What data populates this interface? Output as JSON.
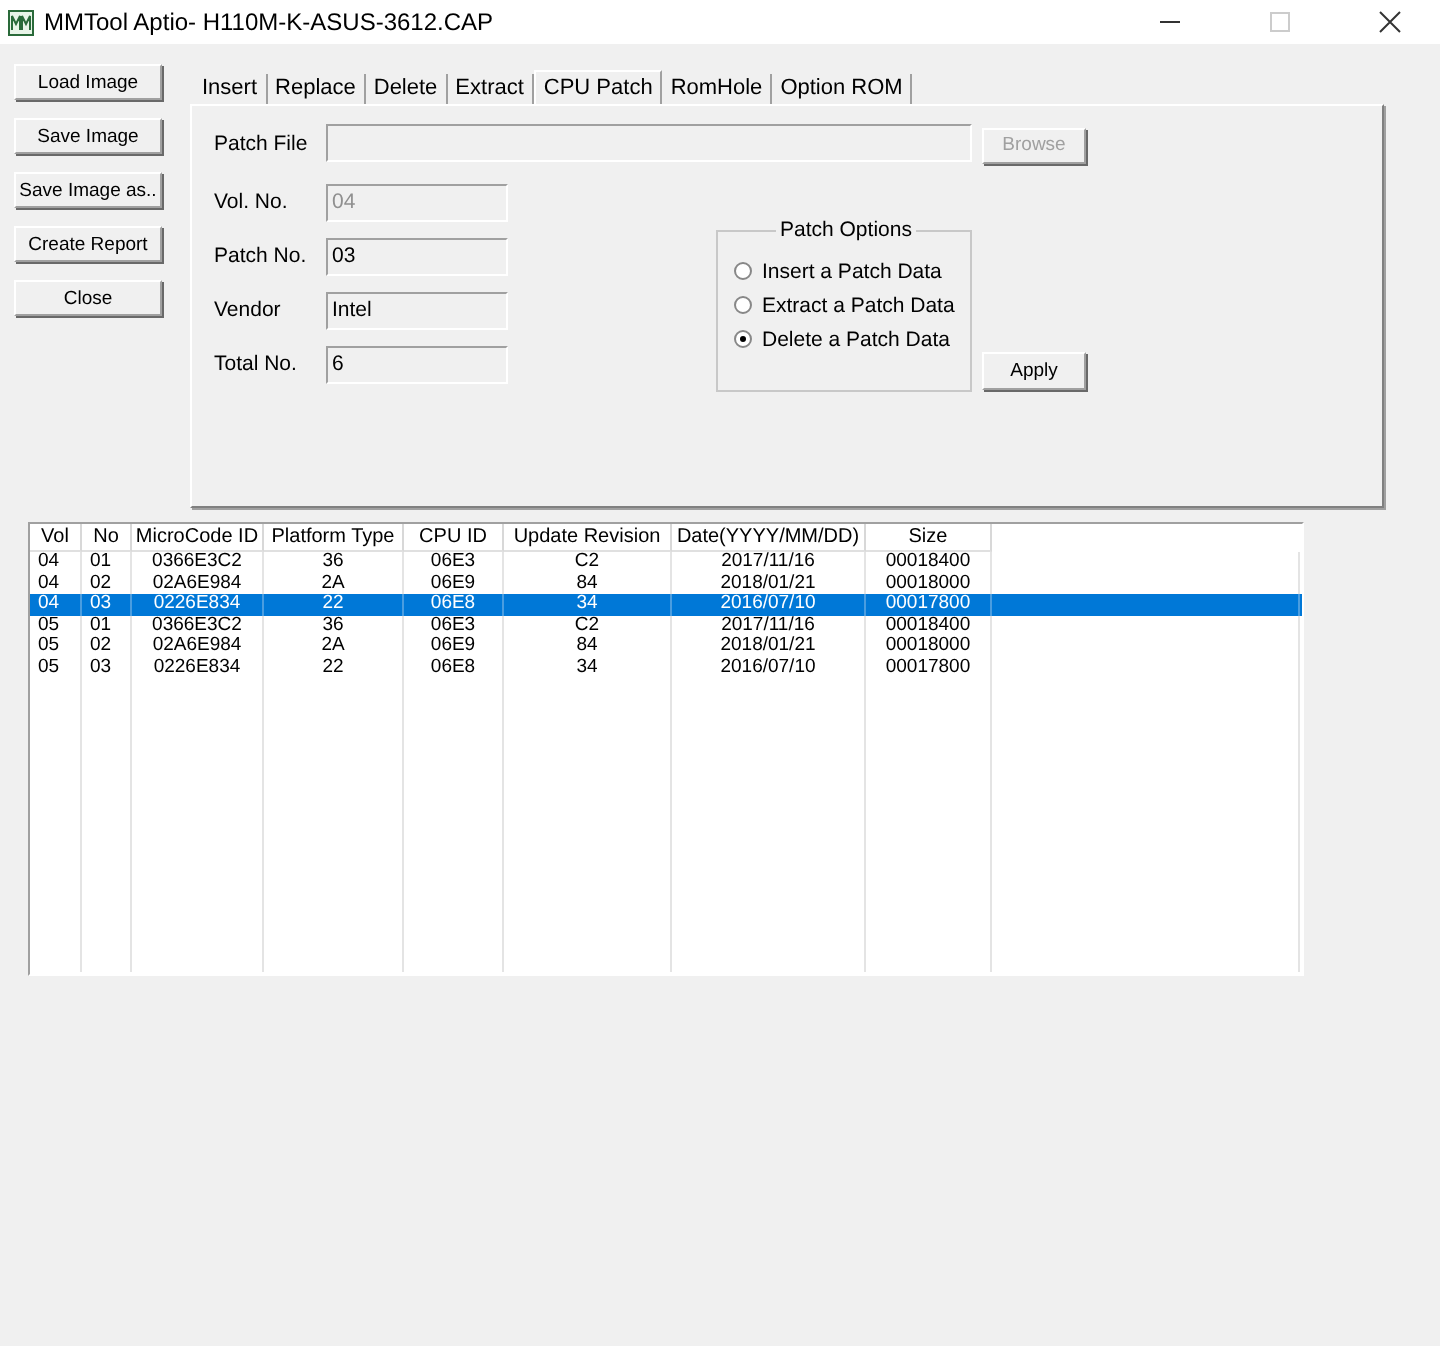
{
  "window": {
    "title": "MMTool Aptio- H110M-K-ASUS-3612.CAP"
  },
  "side_buttons": [
    "Load Image",
    "Save Image",
    "Save Image as..",
    "Create Report",
    "Close"
  ],
  "tabs": [
    {
      "label": "Insert",
      "selected": false
    },
    {
      "label": "Replace",
      "selected": false
    },
    {
      "label": "Delete",
      "selected": false
    },
    {
      "label": "Extract",
      "selected": false
    },
    {
      "label": "CPU Patch",
      "selected": true
    },
    {
      "label": "RomHole",
      "selected": false
    },
    {
      "label": "Option ROM",
      "selected": false
    }
  ],
  "patch_file": {
    "label": "Patch File"
  },
  "browse_button": {
    "label": "Browse",
    "disabled": true
  },
  "fields": [
    {
      "label": "Vol. No.",
      "value": "04",
      "disabled": true
    },
    {
      "label": "Patch No.",
      "value": "03",
      "disabled": false
    },
    {
      "label": "Vendor",
      "value": "Intel",
      "disabled": false
    },
    {
      "label": "Total No.",
      "value": "6",
      "disabled": false
    }
  ],
  "patch_options": {
    "title": "Patch Options",
    "options": [
      {
        "label": "Insert a Patch Data",
        "selected": false
      },
      {
        "label": "Extract a Patch Data",
        "selected": false
      },
      {
        "label": "Delete a Patch Data",
        "selected": true
      }
    ]
  },
  "apply_button": "Apply",
  "table": {
    "columns": [
      "Vol",
      "No",
      "MicroCode ID",
      "Platform Type",
      "CPU ID",
      "Update Revision",
      "Date(YYYY/MM/DD)",
      "Size"
    ],
    "rows": [
      {
        "cells": [
          "04",
          "01",
          "0366E3C2",
          "36",
          "06E3",
          "C2",
          "2017/11/16",
          "00018400"
        ],
        "selected": false
      },
      {
        "cells": [
          "04",
          "02",
          "02A6E984",
          "2A",
          "06E9",
          "84",
          "2018/01/21",
          "00018000"
        ],
        "selected": false
      },
      {
        "cells": [
          "04",
          "03",
          "0226E834",
          "22",
          "06E8",
          "34",
          "2016/07/10",
          "00017800"
        ],
        "selected": true
      },
      {
        "cells": [
          "05",
          "01",
          "0366E3C2",
          "36",
          "06E3",
          "C2",
          "2017/11/16",
          "00018400"
        ],
        "selected": false
      },
      {
        "cells": [
          "05",
          "02",
          "02A6E984",
          "2A",
          "06E9",
          "84",
          "2018/01/21",
          "00018000"
        ],
        "selected": false
      },
      {
        "cells": [
          "05",
          "03",
          "0226E834",
          "22",
          "06E8",
          "34",
          "2016/07/10",
          "00017800"
        ],
        "selected": false
      }
    ]
  }
}
